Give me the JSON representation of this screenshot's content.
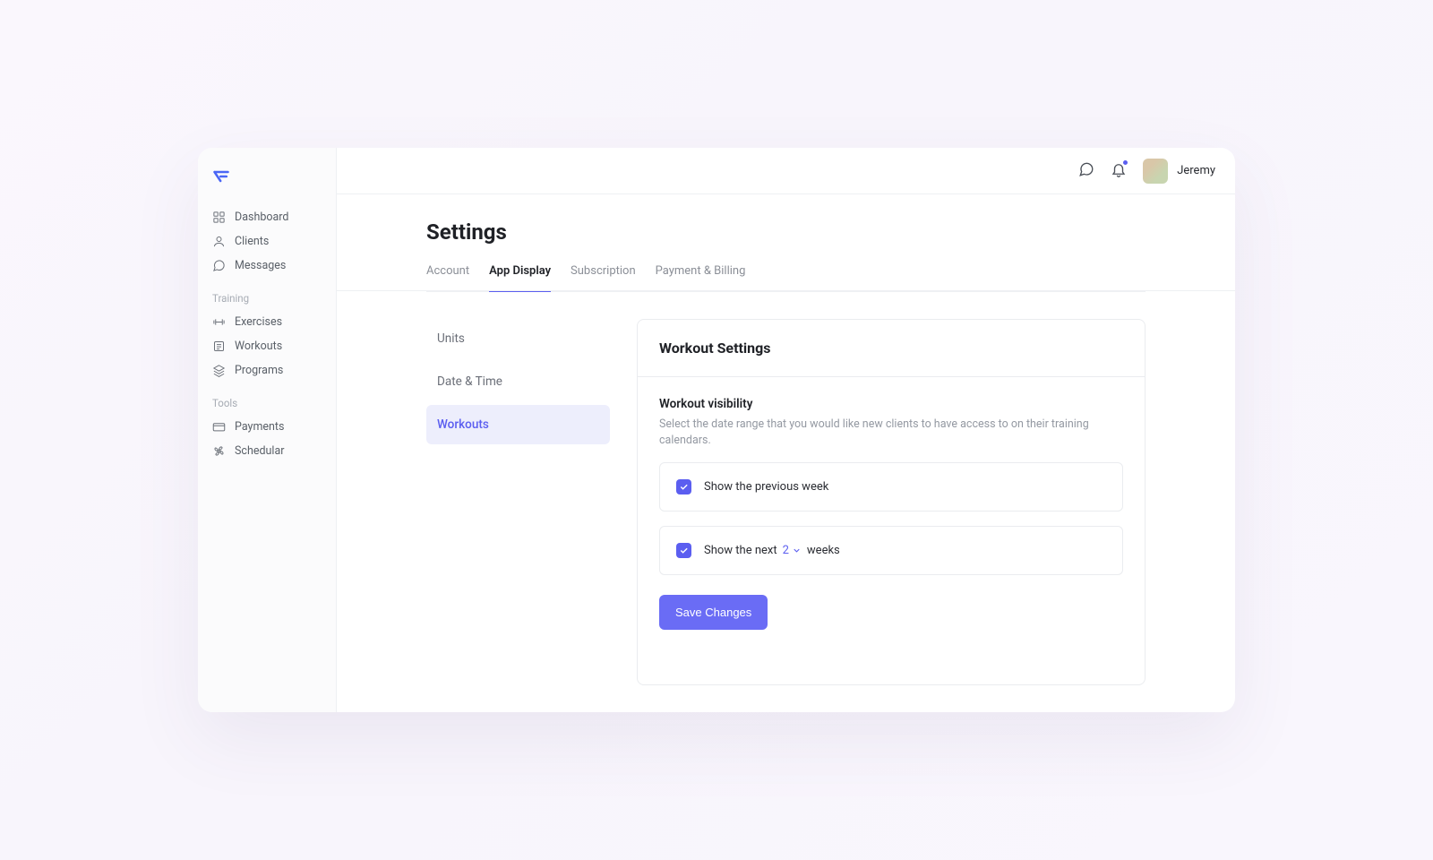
{
  "header": {
    "user_name": "Jeremy"
  },
  "sidebar": {
    "main_items": [
      {
        "label": "Dashboard"
      },
      {
        "label": "Clients"
      },
      {
        "label": "Messages"
      }
    ],
    "training_title": "Training",
    "training_items": [
      {
        "label": "Exercises"
      },
      {
        "label": "Workouts"
      },
      {
        "label": "Programs"
      }
    ],
    "tools_title": "Tools",
    "tools_items": [
      {
        "label": "Payments"
      },
      {
        "label": "Schedular"
      }
    ]
  },
  "page": {
    "title": "Settings",
    "tabs": [
      {
        "label": "Account"
      },
      {
        "label": "App Display",
        "active": true
      },
      {
        "label": "Subscription"
      },
      {
        "label": "Payment & Billing"
      }
    ],
    "subnav": [
      {
        "label": "Units"
      },
      {
        "label": "Date & Time"
      },
      {
        "label": "Workouts",
        "active": true
      }
    ]
  },
  "panel": {
    "title": "Workout Settings",
    "section_title": "Workout visibility",
    "section_desc": "Select the date range that you would like new clients to have access to on their training calendars.",
    "option_prev": {
      "checked": true,
      "label": "Show the previous week"
    },
    "option_next": {
      "checked": true,
      "label_before": "Show the next",
      "value": "2",
      "label_after": "weeks"
    },
    "save_label": "Save Changes"
  }
}
